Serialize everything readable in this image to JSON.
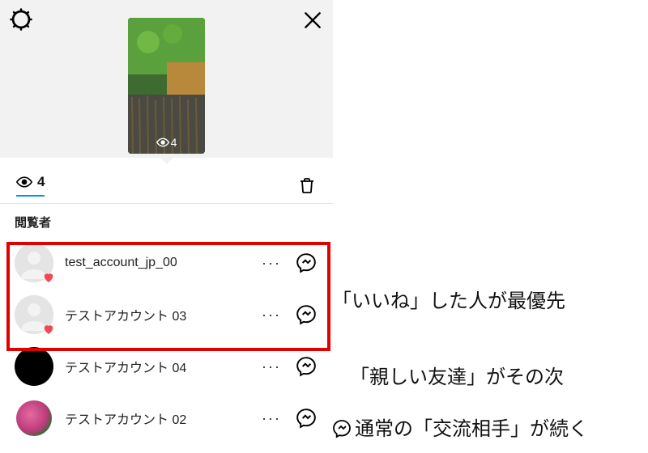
{
  "story": {
    "view_count_overlay": "4"
  },
  "stats": {
    "view_count": "4"
  },
  "viewers_label": "閲覧者",
  "viewers": [
    {
      "name": "test_account_jp_00",
      "avatar_style": "gray",
      "liked": true
    },
    {
      "name": "テストアカウント 03",
      "avatar_style": "gray",
      "liked": true
    },
    {
      "name": "テストアカウント 04",
      "avatar_style": "black",
      "liked": false
    },
    {
      "name": "テストアカウント 02",
      "avatar_style": "gradient",
      "liked": false
    }
  ],
  "annotations": {
    "a1": "「いいね」した人が最優先",
    "a2": "「親しい友達」がその次",
    "a3": "通常の「交流相手」が続く"
  },
  "icons": {
    "gear": "gear-icon",
    "close": "close-icon",
    "eye": "eye-icon",
    "trash": "trash-icon",
    "more": "more-icon",
    "messenger": "messenger-icon",
    "heart": "heart-icon"
  }
}
